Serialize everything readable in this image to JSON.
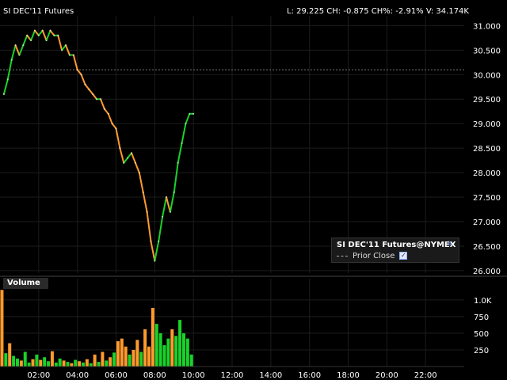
{
  "header": {
    "symbol": "SI DEC'11 Futures",
    "quote": "L: 29.225  CH: -0.875  CH%: -2.91%   V: 34.174K"
  },
  "legend": {
    "title": "SI DEC'11 Futures@NYMEX",
    "prior_close_label": "Prior Close",
    "checkbox": "✓"
  },
  "volume_panel": {
    "title": "Volume"
  },
  "colors": {
    "up": "#19d22a",
    "down": "#ff9a2e",
    "grid": "#1c1c1c",
    "axis_text": "#ffffff",
    "prior_close": "#777777"
  },
  "chart_data": [
    {
      "type": "line",
      "title": "SI DEC'11 Futures",
      "y_ticks": [
        "26.000",
        "26.500",
        "27.000",
        "27.500",
        "28.000",
        "28.500",
        "29.000",
        "29.500",
        "30.000",
        "30.500",
        "31.000"
      ],
      "ylim": [
        25.95,
        31.2
      ],
      "x_ticks": [
        "02:00",
        "04:00",
        "06:00",
        "08:00",
        "10:00",
        "12:00",
        "14:00",
        "16:00",
        "18:00",
        "20:00",
        "22:00"
      ],
      "xlim": [
        0,
        24
      ],
      "prior_close": 30.1,
      "series": [
        {
          "x": [
            0.2,
            0.4,
            0.6,
            0.8,
            1.0,
            1.2,
            1.4,
            1.6,
            1.8,
            2.0,
            2.2,
            2.4,
            2.6,
            2.8,
            3.0,
            3.2,
            3.4,
            3.6,
            3.8,
            4.0,
            4.2,
            4.4,
            4.6,
            4.8,
            5.0,
            5.2,
            5.4,
            5.6,
            5.8,
            6.0,
            6.2,
            6.4,
            6.6,
            6.8,
            7.0,
            7.2,
            7.4,
            7.6,
            7.8,
            8.0,
            8.2,
            8.4,
            8.6,
            8.8,
            9.0,
            9.2,
            9.4,
            9.6,
            9.8,
            10.0
          ],
          "y": [
            29.6,
            29.9,
            30.3,
            30.6,
            30.4,
            30.6,
            30.8,
            30.7,
            30.9,
            30.8,
            30.9,
            30.7,
            30.9,
            30.8,
            30.8,
            30.5,
            30.6,
            30.4,
            30.4,
            30.1,
            30.0,
            29.8,
            29.7,
            29.6,
            29.5,
            29.5,
            29.3,
            29.2,
            29.0,
            28.9,
            28.5,
            28.2,
            28.3,
            28.4,
            28.2,
            28.0,
            27.6,
            27.2,
            26.6,
            26.2,
            26.6,
            27.1,
            27.5,
            27.2,
            27.6,
            28.2,
            28.6,
            29.0,
            29.2,
            29.2
          ]
        }
      ]
    },
    {
      "type": "bar",
      "title": "Volume",
      "y_ticks": [
        "1.0K",
        "750",
        "500",
        "250"
      ],
      "ylim": [
        0,
        1200
      ],
      "x_ticks": [
        "02:00",
        "04:00",
        "06:00",
        "08:00",
        "10:00",
        "12:00",
        "14:00",
        "16:00",
        "18:00",
        "20:00",
        "22:00"
      ],
      "xlim": [
        0,
        24
      ],
      "bars": [
        {
          "x": 0.1,
          "v": 1150,
          "dir": "down"
        },
        {
          "x": 0.3,
          "v": 200,
          "dir": "up"
        },
        {
          "x": 0.5,
          "v": 350,
          "dir": "down"
        },
        {
          "x": 0.7,
          "v": 160,
          "dir": "up"
        },
        {
          "x": 0.9,
          "v": 120,
          "dir": "up"
        },
        {
          "x": 1.1,
          "v": 90,
          "dir": "down"
        },
        {
          "x": 1.3,
          "v": 220,
          "dir": "up"
        },
        {
          "x": 1.5,
          "v": 60,
          "dir": "up"
        },
        {
          "x": 1.7,
          "v": 110,
          "dir": "down"
        },
        {
          "x": 1.9,
          "v": 180,
          "dir": "up"
        },
        {
          "x": 2.1,
          "v": 100,
          "dir": "down"
        },
        {
          "x": 2.3,
          "v": 140,
          "dir": "up"
        },
        {
          "x": 2.5,
          "v": 80,
          "dir": "up"
        },
        {
          "x": 2.7,
          "v": 230,
          "dir": "down"
        },
        {
          "x": 2.9,
          "v": 60,
          "dir": "up"
        },
        {
          "x": 3.1,
          "v": 120,
          "dir": "up"
        },
        {
          "x": 3.3,
          "v": 90,
          "dir": "down"
        },
        {
          "x": 3.5,
          "v": 70,
          "dir": "up"
        },
        {
          "x": 3.7,
          "v": 50,
          "dir": "down"
        },
        {
          "x": 3.9,
          "v": 100,
          "dir": "up"
        },
        {
          "x": 4.1,
          "v": 80,
          "dir": "down"
        },
        {
          "x": 4.3,
          "v": 60,
          "dir": "up"
        },
        {
          "x": 4.5,
          "v": 110,
          "dir": "down"
        },
        {
          "x": 4.7,
          "v": 50,
          "dir": "up"
        },
        {
          "x": 4.9,
          "v": 180,
          "dir": "down"
        },
        {
          "x": 5.1,
          "v": 70,
          "dir": "up"
        },
        {
          "x": 5.3,
          "v": 220,
          "dir": "down"
        },
        {
          "x": 5.5,
          "v": 90,
          "dir": "up"
        },
        {
          "x": 5.7,
          "v": 140,
          "dir": "down"
        },
        {
          "x": 5.9,
          "v": 210,
          "dir": "up"
        },
        {
          "x": 6.1,
          "v": 380,
          "dir": "down"
        },
        {
          "x": 6.3,
          "v": 420,
          "dir": "down"
        },
        {
          "x": 6.5,
          "v": 300,
          "dir": "down"
        },
        {
          "x": 6.7,
          "v": 180,
          "dir": "up"
        },
        {
          "x": 6.9,
          "v": 250,
          "dir": "down"
        },
        {
          "x": 7.1,
          "v": 400,
          "dir": "down"
        },
        {
          "x": 7.3,
          "v": 220,
          "dir": "up"
        },
        {
          "x": 7.5,
          "v": 560,
          "dir": "down"
        },
        {
          "x": 7.7,
          "v": 300,
          "dir": "down"
        },
        {
          "x": 7.9,
          "v": 880,
          "dir": "down"
        },
        {
          "x": 8.1,
          "v": 640,
          "dir": "up"
        },
        {
          "x": 8.3,
          "v": 500,
          "dir": "up"
        },
        {
          "x": 8.5,
          "v": 320,
          "dir": "up"
        },
        {
          "x": 8.7,
          "v": 420,
          "dir": "up"
        },
        {
          "x": 8.9,
          "v": 560,
          "dir": "down"
        },
        {
          "x": 9.1,
          "v": 460,
          "dir": "up"
        },
        {
          "x": 9.3,
          "v": 700,
          "dir": "up"
        },
        {
          "x": 9.5,
          "v": 500,
          "dir": "up"
        },
        {
          "x": 9.7,
          "v": 420,
          "dir": "up"
        },
        {
          "x": 9.9,
          "v": 180,
          "dir": "up"
        }
      ]
    }
  ]
}
